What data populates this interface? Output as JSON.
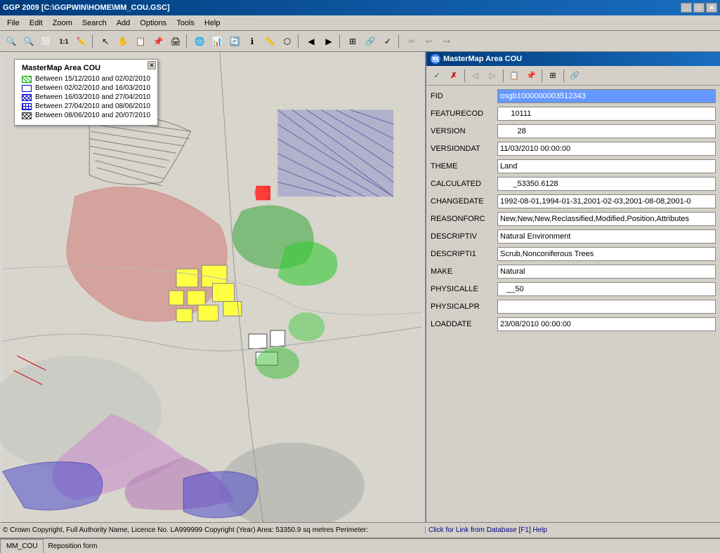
{
  "titleBar": {
    "title": "GGP 2009 [C:\\GGPWIN\\HOME\\MM_COU.GSC]",
    "buttons": [
      "minimize",
      "maximize",
      "close"
    ]
  },
  "menuBar": {
    "items": [
      "File",
      "Edit",
      "Zoom",
      "Search",
      "Add",
      "Options",
      "Tools",
      "Help"
    ]
  },
  "legend": {
    "title": "MasterMap Area COU",
    "items": [
      {
        "color": "#00cc00",
        "pattern": "hatch-green",
        "text": "Between 15/12/2010 and 02/02/2010"
      },
      {
        "color": "#0000cc",
        "pattern": "hatch-blue",
        "text": "Between 02/02/2010 and 16/03/2010"
      },
      {
        "color": "#0000cc",
        "pattern": "hatch-blue-x",
        "text": "Between 16/03/2010 and 27/04/2010"
      },
      {
        "color": "#0000cc",
        "pattern": "hatch-blue-xb",
        "text": "Between 27/04/2010 and 08/06/2010"
      },
      {
        "color": "#333333",
        "pattern": "hatch-black-x",
        "text": "Between 08/06/2010 and 20/07/2010"
      }
    ]
  },
  "attrPanel": {
    "title": "MasterMap Area COU",
    "toolbar": {
      "buttons": [
        "check",
        "x",
        "left",
        "right",
        "copy",
        "paste",
        "multiline",
        "info"
      ]
    },
    "fields": [
      {
        "label": "FID",
        "value": "osgb1000000003512343",
        "highlight": true
      },
      {
        "label": "FEATURECOD",
        "value": "     10111"
      },
      {
        "label": "VERSION",
        "value": "        28"
      },
      {
        "label": "VERSIONDAT",
        "value": "11/03/2010 00:00:00"
      },
      {
        "label": "THEME",
        "value": "Land"
      },
      {
        "label": "CALCULATED",
        "value": "      _53350.6128"
      },
      {
        "label": "CHANGEDATE",
        "value": "1992-08-01,1994-01-31,2001-02-03,2001-08-08,2001-0"
      },
      {
        "label": "REASONFORC",
        "value": "New,New,New,Reclassified,Modified,Position,Attributes"
      },
      {
        "label": "DESCRIPTIV",
        "value": "Natural Environment"
      },
      {
        "label": "DESCRIPTI1",
        "value": "Scrub,Nonconiferous Trees"
      },
      {
        "label": "MAKE",
        "value": "Natural"
      },
      {
        "label": "PHYSICALLE",
        "value": "   __50"
      },
      {
        "label": "PHYSICALPR",
        "value": ""
      },
      {
        "label": "LOADDATE",
        "value": "23/08/2010 00:00:00"
      }
    ]
  },
  "statusBar": {
    "left": "© Crown Copyright, Full Authority Name, Licence No. LA999999 Copyright (Year)  Area: 53350.9 sq metres  Perimeter:",
    "right": "Click for Link from Database  [F1] Help"
  },
  "bottomBar": {
    "tab": "MM_COU",
    "status": "Reposition form"
  }
}
